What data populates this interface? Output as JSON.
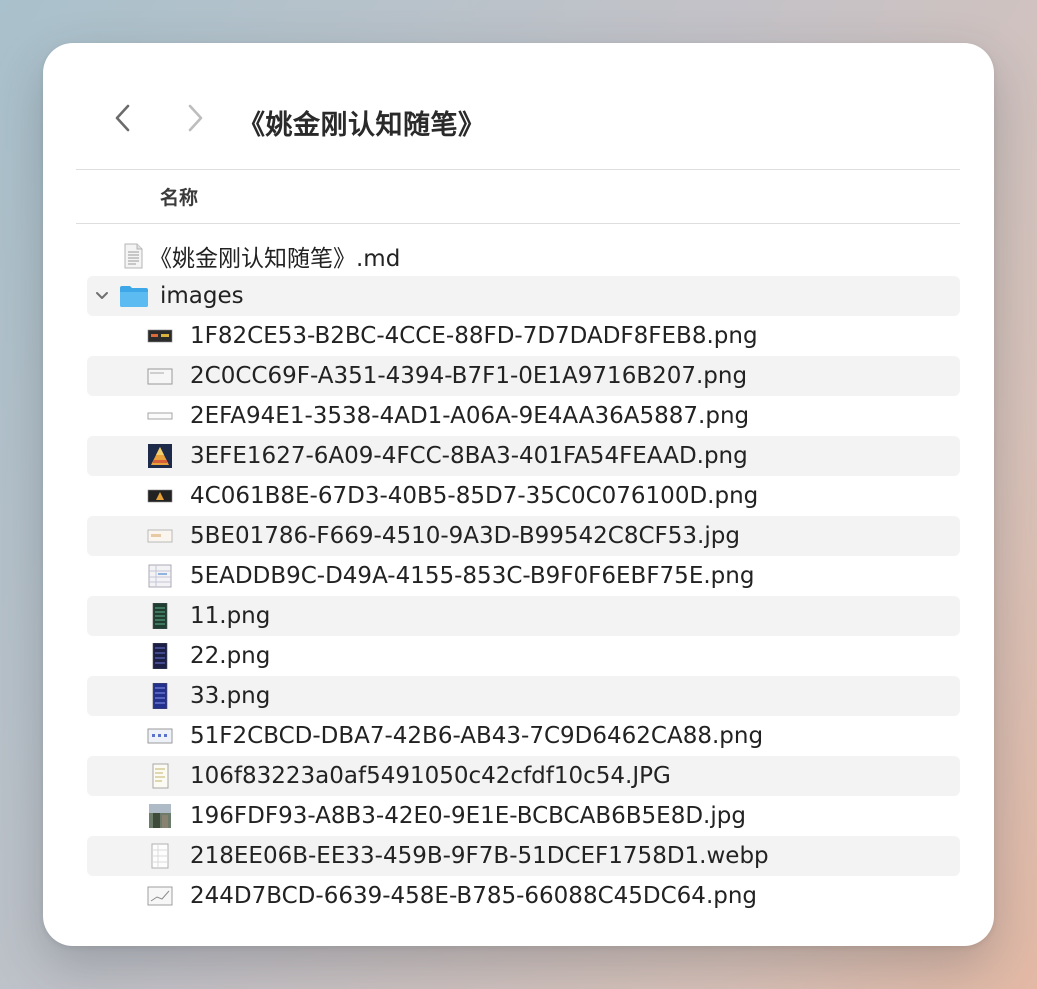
{
  "window": {
    "title": "《姚金刚认知随笔》",
    "column_name": "名称"
  },
  "files": [
    {
      "name": "《姚金刚认知随笔》.md",
      "icon": "markdown-file-icon",
      "level": 0
    },
    {
      "name": "images",
      "icon": "folder-icon",
      "level": 0,
      "expanded": true
    }
  ],
  "images": [
    {
      "name": "1F82CE53-B2BC-4CCE-88FD-7D7DADF8FEB8.png",
      "thumb": "dark-wide"
    },
    {
      "name": "2C0CC69F-A351-4394-B7F1-0E1A9716B207.png",
      "thumb": "light-box"
    },
    {
      "name": "2EFA94E1-3538-4AD1-A06A-9E4AA36A5887.png",
      "thumb": "thin-bar"
    },
    {
      "name": "3EFE1627-6A09-4FCC-8BA3-401FA54FEAAD.png",
      "thumb": "pyramid"
    },
    {
      "name": "4C061B8E-67D3-40B5-85D7-35C0C076100D.png",
      "thumb": "dark-wide-mark"
    },
    {
      "name": "5BE01786-F669-4510-9A3D-B99542C8CF53.jpg",
      "thumb": "light-wide"
    },
    {
      "name": "5EADDB9C-D49A-4155-853C-B9F0F6EBF75E.png",
      "thumb": "table-light"
    },
    {
      "name": "11.png",
      "thumb": "tall-green"
    },
    {
      "name": "22.png",
      "thumb": "tall-navy"
    },
    {
      "name": "33.png",
      "thumb": "tall-blue"
    },
    {
      "name": "51F2CBCD-DBA7-42B6-AB43-7C9D6462CA88.png",
      "thumb": "light-box-blue"
    },
    {
      "name": "106f83223a0af5491050c42cfdf10c54.JPG",
      "thumb": "tall-doc"
    },
    {
      "name": "196FDF93-A8B3-42E0-9E1E-BCBCAB6B5E8D.jpg",
      "thumb": "photo"
    },
    {
      "name": "218EE06B-EE33-459B-9F7B-51DCEF1758D1.webp",
      "thumb": "tall-white"
    },
    {
      "name": "244D7BCD-6639-458E-B785-66088C45DC64.png",
      "thumb": "chart-light"
    }
  ]
}
